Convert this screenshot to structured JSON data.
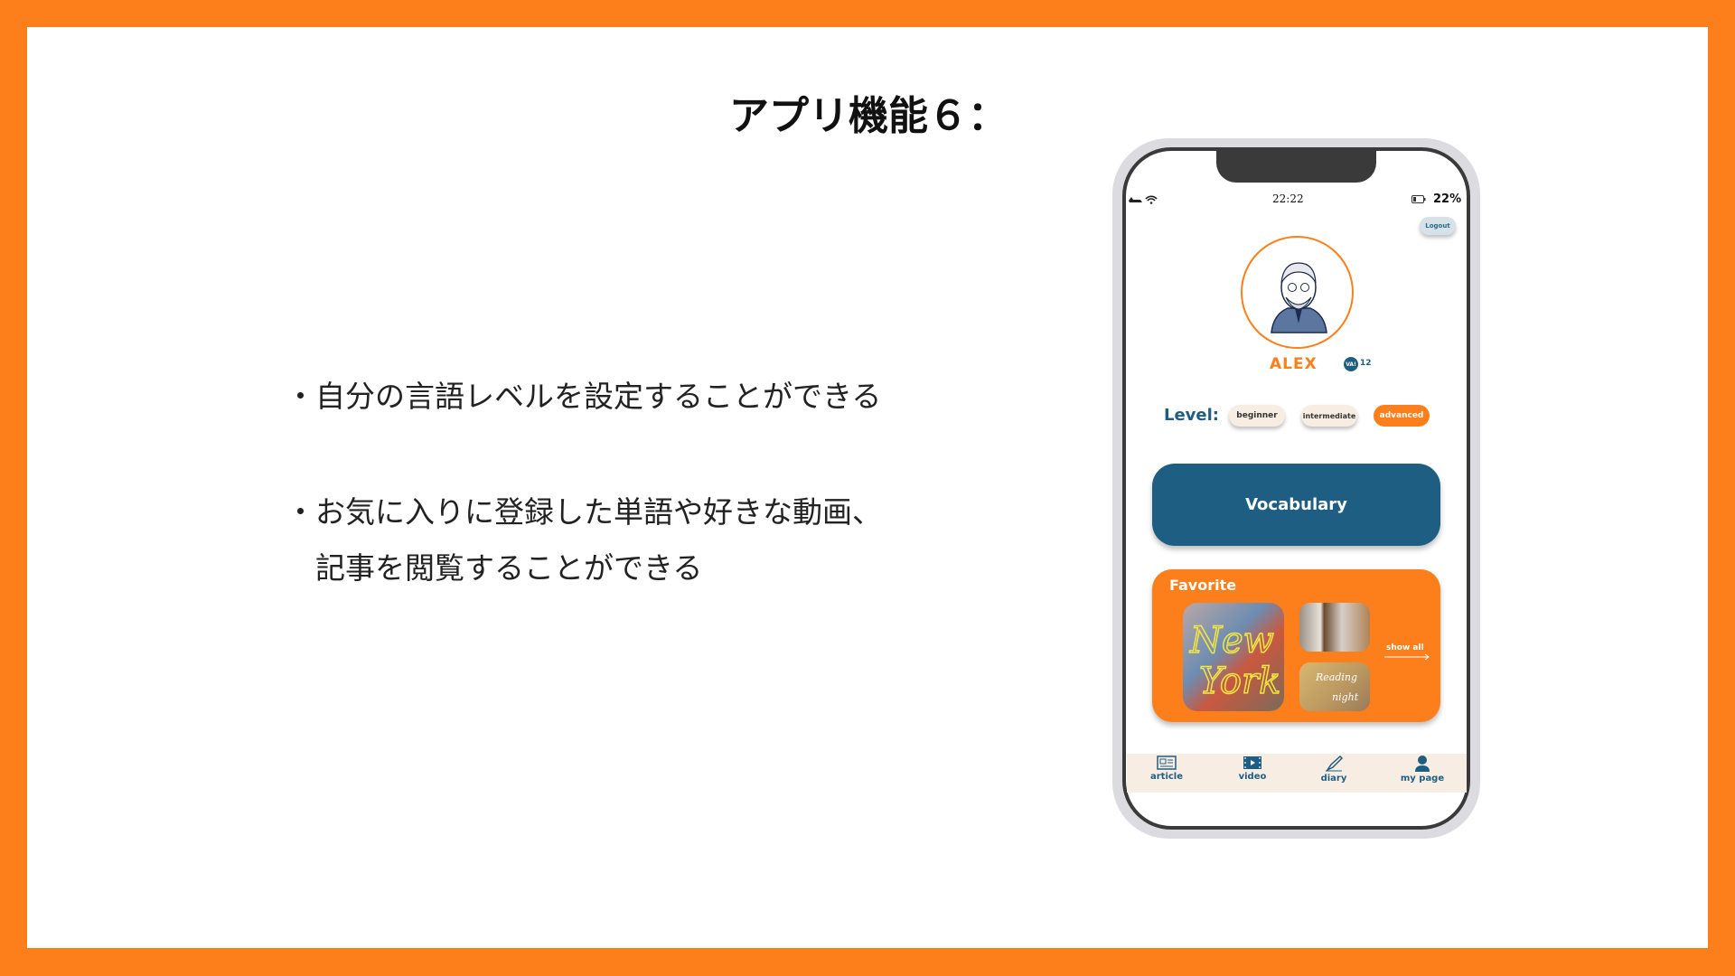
{
  "slide": {
    "title": "アプリ機能６：",
    "bullets": [
      "・自分の言語レベルを設定することができる",
      "・お気に入りに登録した単語や好きな動画、",
      "　記事を閲覧することができる"
    ]
  },
  "phone": {
    "status": {
      "time": "22:22",
      "battery": "22%",
      "icons": [
        "airplane-icon",
        "wifi-icon",
        "battery-icon"
      ]
    },
    "logout_label": "Logout",
    "profile": {
      "name": "ALEX",
      "badge": "VA!",
      "badge_count": "12"
    },
    "level": {
      "label": "Level:",
      "options": [
        "beginner",
        "intermediate",
        "advanced"
      ],
      "selected": "advanced"
    },
    "vocabulary_label": "Vocabulary",
    "favorite": {
      "title": "Favorite",
      "show_all": "show all",
      "thumbnails": [
        "New York",
        "photos collage",
        "Reading @ night"
      ]
    },
    "nav": [
      {
        "label": "article",
        "icon": "newspaper-icon"
      },
      {
        "label": "video",
        "icon": "film-icon"
      },
      {
        "label": "diary",
        "icon": "pen-icon"
      },
      {
        "label": "my page",
        "icon": "user-icon"
      }
    ],
    "colors": {
      "orange": "#fd7f1c",
      "navy": "#1e5e82",
      "cream": "#f8ede3",
      "logout_bg": "#d6e1e8"
    }
  }
}
